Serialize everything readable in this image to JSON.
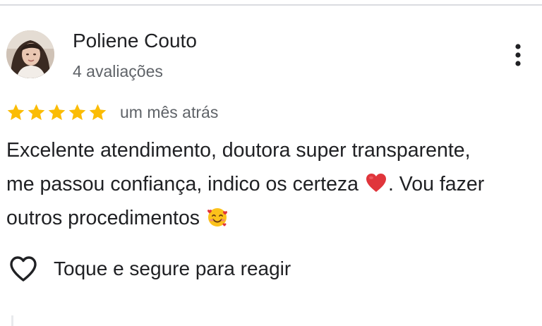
{
  "reviewer": {
    "name": "Poliene Couto",
    "review_count": "4 avaliações",
    "avatar_icon": "profile-photo"
  },
  "more_options_icon": "more-vert-icon",
  "review": {
    "rating": 5,
    "rating_max": 5,
    "star_color": "#fbbc04",
    "date": "um mês atrás",
    "lines": [
      {
        "before": "Excelente atendimento, doutora super transparente,",
        "after": ""
      },
      {
        "before": "me passou confiança, indico os certeza ",
        "after": ". Vou fazer"
      },
      {
        "before": "outros procedimentos ",
        "after": ""
      }
    ],
    "emojis": [
      "red-heart-emoji",
      "smiling-face-with-hearts-emoji"
    ]
  },
  "react": {
    "label": "Toque e segure para reagir",
    "icon": "heart-outline-icon"
  }
}
